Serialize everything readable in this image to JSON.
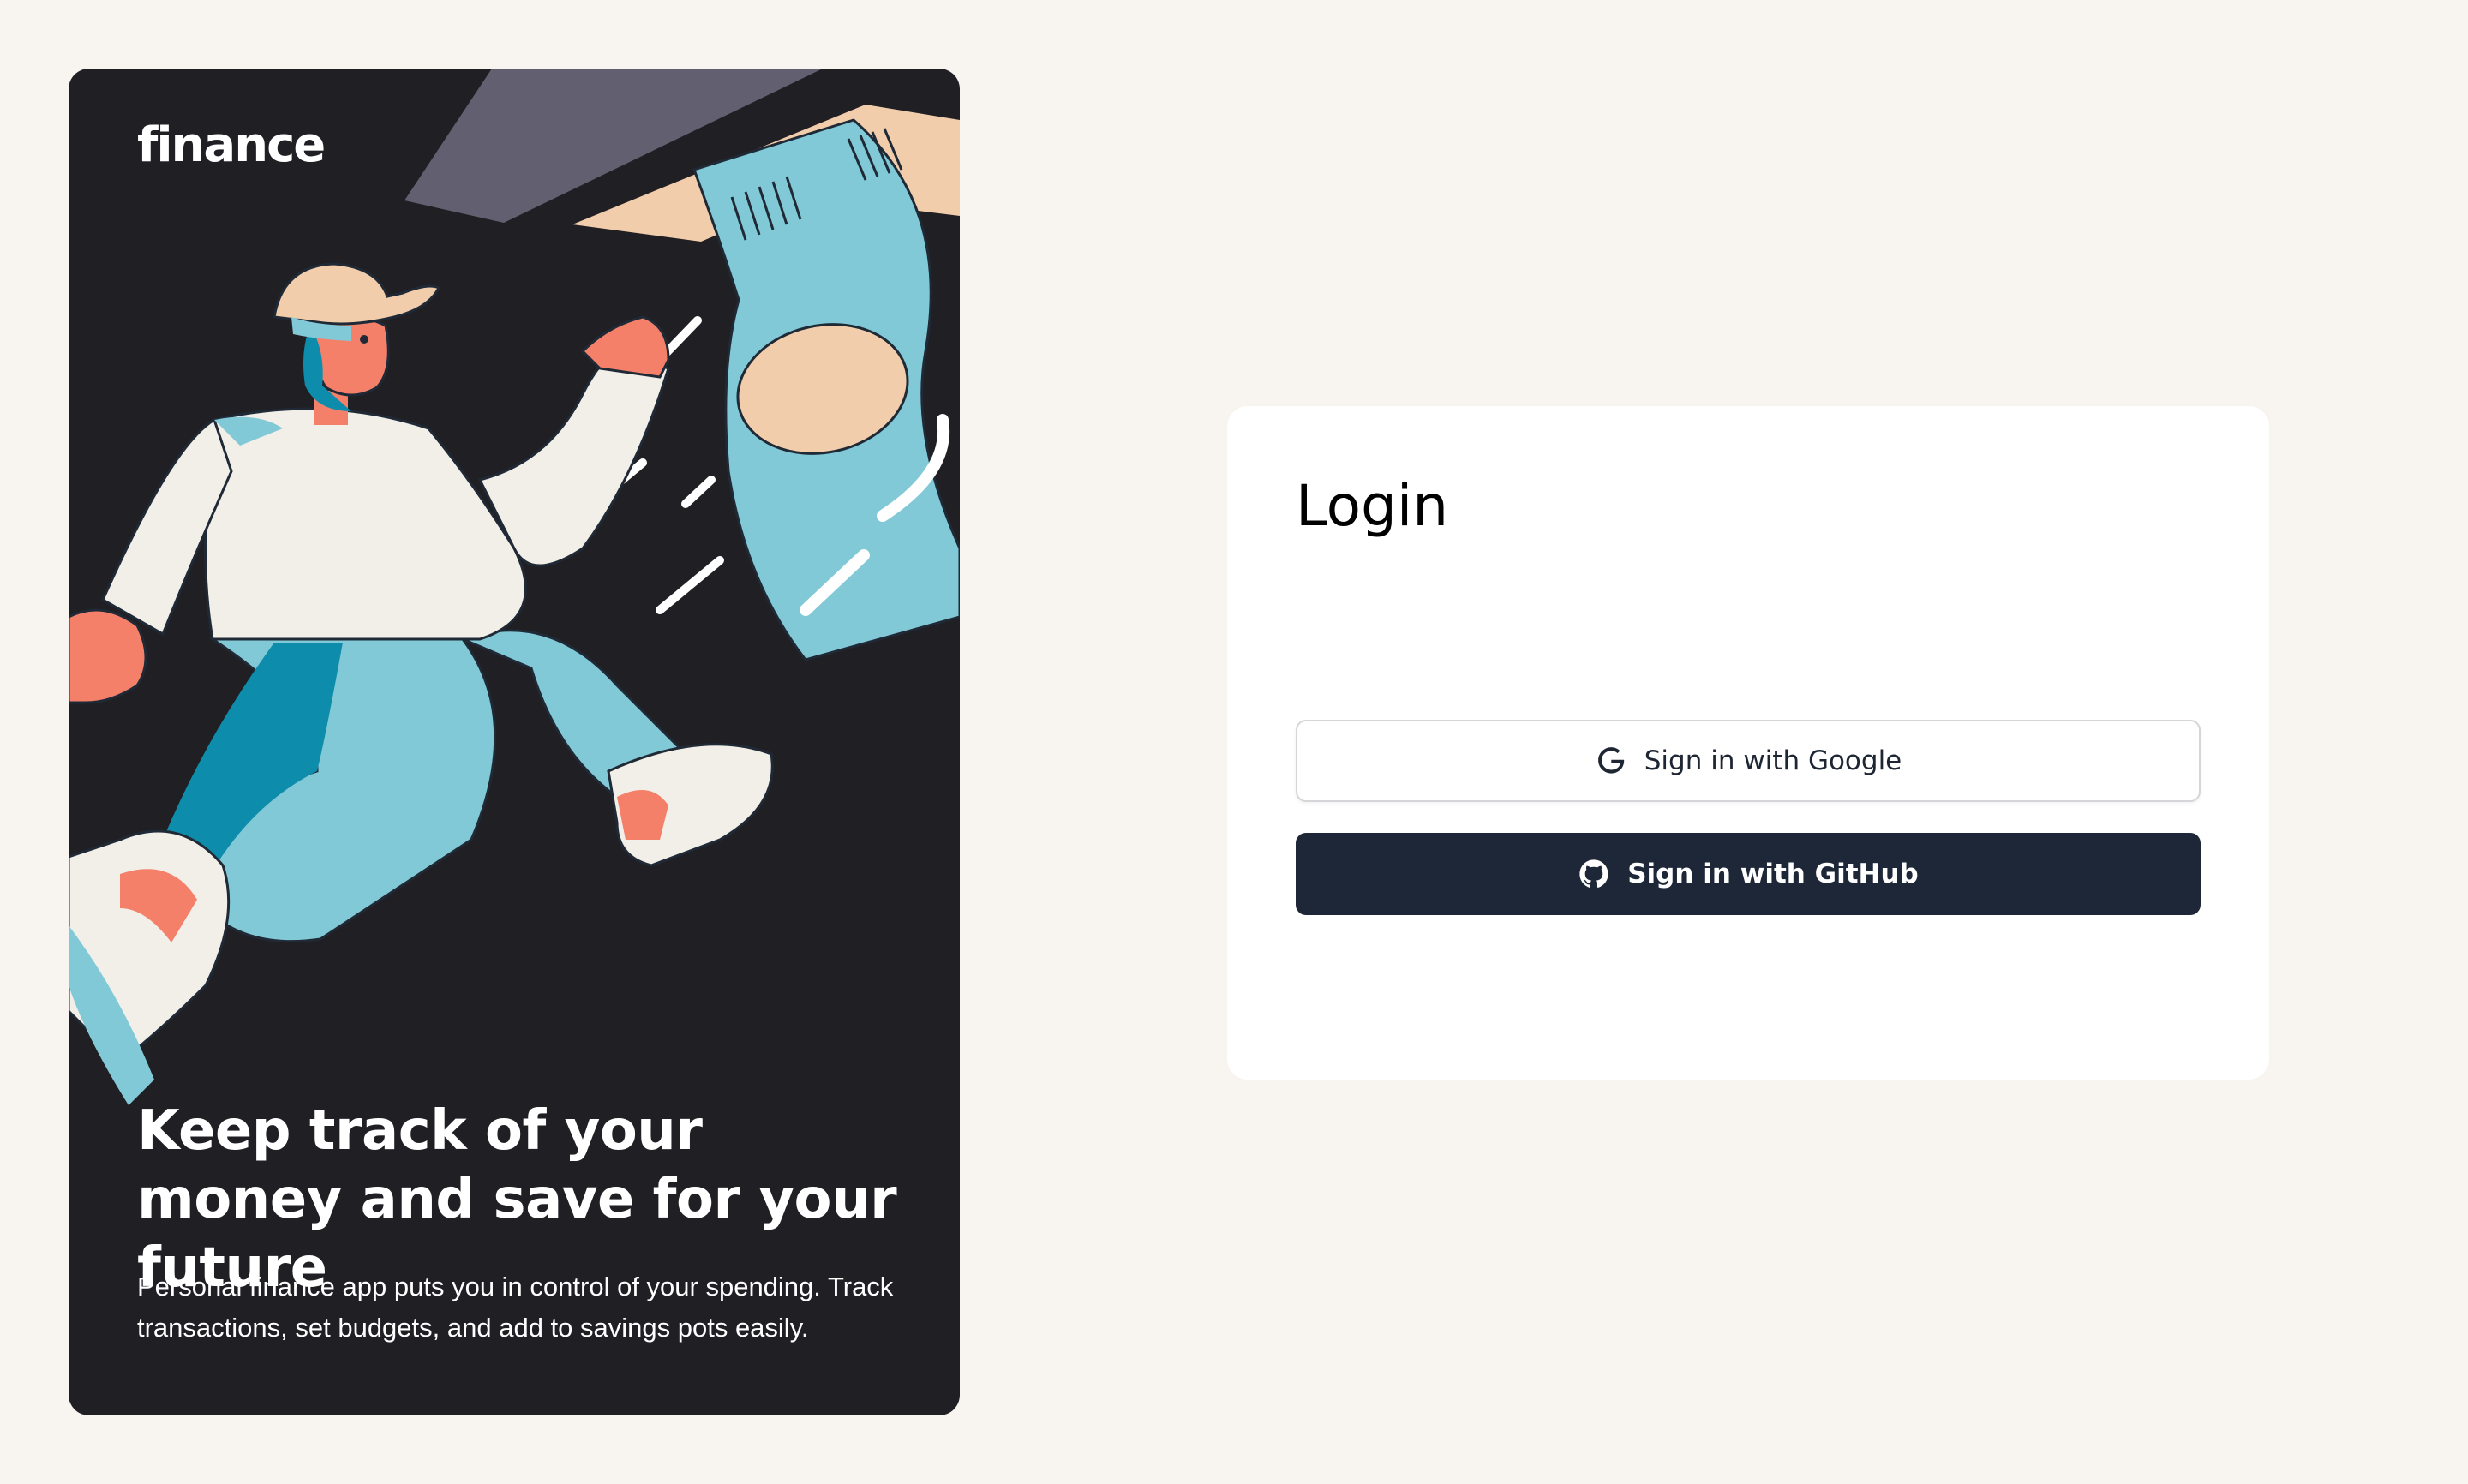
{
  "hero": {
    "logo_text": "finance",
    "title": "Keep track of your money and save for your future",
    "description": "Personal finance app puts you in control of your spending. Track transactions, set budgets, and add to savings pots easily."
  },
  "login": {
    "title": "Login",
    "google_button": {
      "label": "Sign in with Google",
      "icon": "google-icon"
    },
    "github_button": {
      "label": "Sign in with GitHub",
      "icon": "github-icon"
    }
  },
  "colors": {
    "page_background": "#F8F4F0",
    "hero_background": "#201F24",
    "card_background": "#FFFFFF",
    "github_button": "#1E2737",
    "illustration_blue": "#82C9D7",
    "illustration_dark_blue": "#0E8CAB",
    "illustration_beige": "#F2CDAC",
    "illustration_salmon": "#F4806A"
  }
}
